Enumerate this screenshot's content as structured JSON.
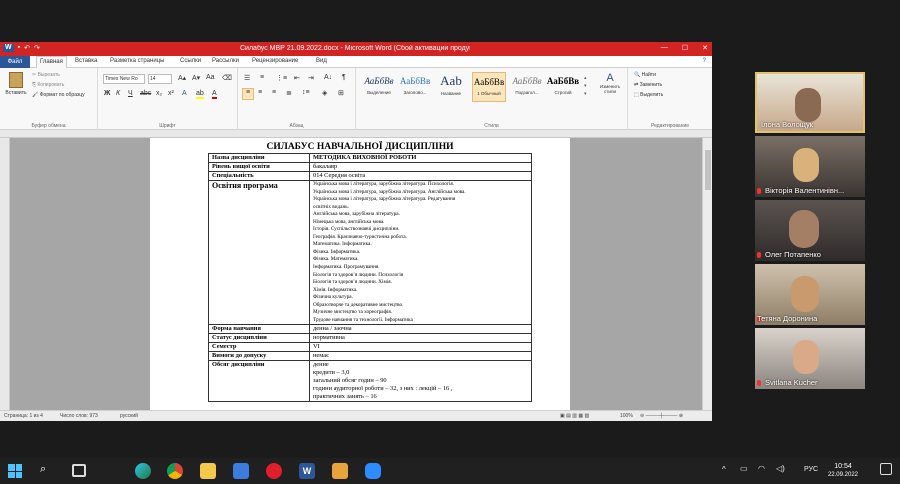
{
  "word": {
    "title": "Силабус МВР 21.09.2022.docx - Microsoft Word (Сбой активации продукта)",
    "tabs": [
      "Файл",
      "Главная",
      "Вставка",
      "Разметка страницы",
      "Ссылки",
      "Рассылки",
      "Рецензирование",
      "Вид"
    ],
    "active_tab": "Главная",
    "clipboard": {
      "paste": "Вставить",
      "cut": "Вырезать",
      "copy": "Копировать",
      "format_painter": "Формат по образцу",
      "label": "Буфер обмена"
    },
    "font": {
      "name": "Times New Ro",
      "size": "14",
      "label": "Шрифт"
    },
    "paragraph": {
      "label": "Абзац"
    },
    "styles": {
      "label": "Стили",
      "items": [
        {
          "sample": "АаБбВв",
          "name": "Выделение"
        },
        {
          "sample": "АаБбВв",
          "name": "Заголово..."
        },
        {
          "sample": "Aab",
          "name": "Название"
        },
        {
          "sample": "АаБбВв",
          "name": "1 Обычный"
        },
        {
          "sample": "АаБбВв",
          "name": "Подзагол..."
        },
        {
          "sample": "АаБбВв",
          "name": "Строгий"
        }
      ],
      "change": "Изменить стили"
    },
    "editing": {
      "label": "Редактирование",
      "find": "Найти",
      "replace": "Заменить",
      "select": "Выделить"
    },
    "status": {
      "page": "Страница: 1 из 4",
      "words": "Число слов: 973",
      "lang": "русский",
      "zoom": "100%"
    }
  },
  "document": {
    "title": "СИЛАБУС НАВЧАЛЬНОЇ ДИСЦИПЛІНИ",
    "rows": [
      {
        "label": "Назва дисципліни",
        "value": "МЕТОДИКА ВИХОВНОЇ РОБОТИ",
        "bold_value": true
      },
      {
        "label": "Рівень вищої освіти",
        "value": "бакалавр"
      },
      {
        "label": "Спеціальність",
        "value": "014 Середня освіта"
      },
      {
        "label": "Освітня програма",
        "lines": [
          "Українська мова і література, зарубіжна література. Психологія.",
          "Українська мова і література, зарубіжна література. Англійська мова.",
          "Українська мова і література, зарубіжна література. Редагування",
          "освітніх видань.",
          "Англійська мова, зарубіжна література.",
          "Німецька мова, англійська мова.",
          "Історія. Суспільствознавчі дисципліни.",
          "Географія. Краєзнавчо-туристична робота.",
          "Математика. Інформатика.",
          "Фізика. Інформатика.",
          "Фізика. Математика.",
          "Інформатика. Програмування.",
          "Біологія та здоров’я людини. Психологія",
          "Біологія та здоров’я людини. Хімія.",
          "Хімія. Інформатика.",
          "Фізична культура.",
          "Образотворче та декоративне мистецтво.",
          "Музичне мистецтво та хореографія.",
          "Трудове навчання та технології. Інформатика"
        ]
      },
      {
        "label": "Форма навчання",
        "value": "денна / заочна"
      },
      {
        "label": "Статус дисципліни",
        "value": "нормативна"
      },
      {
        "label": "Семестр",
        "value": "VI"
      },
      {
        "label": "Вимоги до допуску",
        "value": "немає"
      },
      {
        "label": "Обсяг дисципліни",
        "lines": [
          "денне",
          "кредити – 3,0",
          "загальний обсяг годин – 90",
          "години аудиторної роботи – 32,  з них : лекцій – 16 ,",
          "практичних занять – 16"
        ]
      }
    ]
  },
  "participants": [
    {
      "name": "Ілона Волощук"
    },
    {
      "name": "Вікторія Валентинівн..."
    },
    {
      "name": "Олег Потапенко"
    },
    {
      "name": "Тетяна Доронина"
    },
    {
      "name": "Svitlana Kucher"
    }
  ],
  "taskbar": {
    "time": "10:54",
    "date": "22.09.2022",
    "lang": "РУС"
  },
  "colors": {
    "title_bar": "#d32424",
    "file_tab": "#2b579a",
    "taskbar": "#202020",
    "active_speaker": "#e0c36b"
  }
}
